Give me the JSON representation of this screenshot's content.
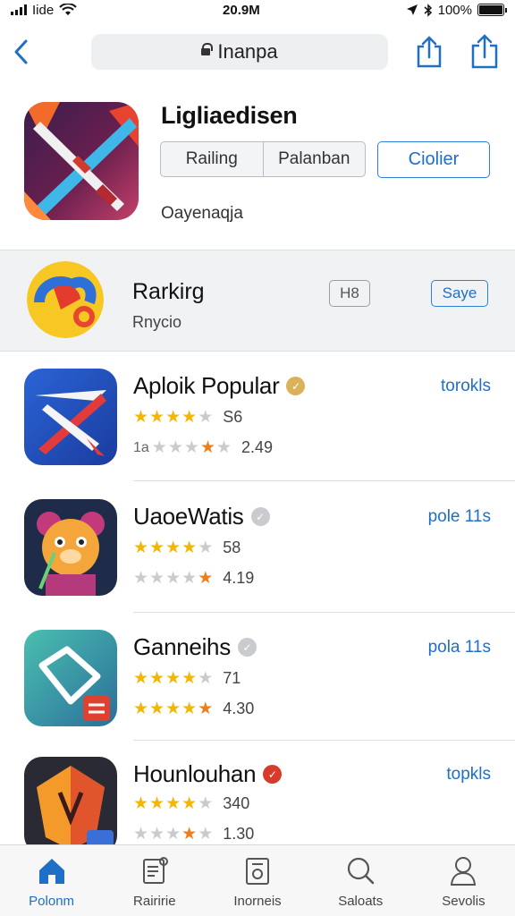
{
  "status_bar": {
    "carrier": "Iide",
    "time": "20.9M",
    "battery": "100%"
  },
  "nav": {
    "url": "Inanpa"
  },
  "hero": {
    "title": "Ligliaedisen",
    "seg_left": "Railing",
    "seg_right": "Palanban",
    "button": "Ciolier",
    "subtitle": "Oayenaqja"
  },
  "ranking": {
    "title": "Rarkirg",
    "subtitle": "Rnycio",
    "badge": "H8",
    "button": "Saye"
  },
  "apps": [
    {
      "title": "Aploik Popular",
      "badge_color": "#d9b25a",
      "action": "torokls",
      "rating1": {
        "stars": [
          "y",
          "y",
          "y",
          "y",
          "g"
        ],
        "value": "S6"
      },
      "rating2": {
        "stars": [
          "g",
          "g",
          "g",
          "o",
          "g"
        ],
        "value": "2.49",
        "prefix": "1a"
      }
    },
    {
      "title": "UaoeWatis",
      "badge_color": "#b9bcc2",
      "action": "pole 11s",
      "rating1": {
        "stars": [
          "y",
          "y",
          "y",
          "y",
          "g"
        ],
        "value": "58"
      },
      "rating2": {
        "stars": [
          "g",
          "g",
          "g",
          "g",
          "o"
        ],
        "value": "4.19",
        "prefix": ""
      }
    },
    {
      "title": "Ganneihs",
      "badge_color": "#b9bcc2",
      "action": "pola 11s",
      "rating1": {
        "stars": [
          "y",
          "y",
          "y",
          "y",
          "g"
        ],
        "value": "71"
      },
      "rating2": {
        "stars": [
          "y",
          "y",
          "y",
          "y",
          "o"
        ],
        "value": "4.30",
        "prefix": ""
      }
    },
    {
      "title": "Hounlouhan",
      "badge_color": "#d83a2c",
      "action": "topkls",
      "rating1": {
        "stars": [
          "y",
          "y",
          "y",
          "y",
          "g"
        ],
        "value": "340"
      },
      "rating2": {
        "stars": [
          "g",
          "g",
          "g",
          "o",
          "g"
        ],
        "value": "1.30",
        "prefix": ""
      }
    }
  ],
  "tabs": [
    {
      "label": "Polonm",
      "icon": "home-icon"
    },
    {
      "label": "Rairirie",
      "icon": "news-icon"
    },
    {
      "label": "Inorneis",
      "icon": "camera-icon"
    },
    {
      "label": "Saloats",
      "icon": "search-icon"
    },
    {
      "label": "Sevolis",
      "icon": "person-icon"
    }
  ],
  "colors": {
    "accent": "#1f6fc6",
    "star_yellow": "#f2b705",
    "star_orange": "#ee7d1b"
  }
}
